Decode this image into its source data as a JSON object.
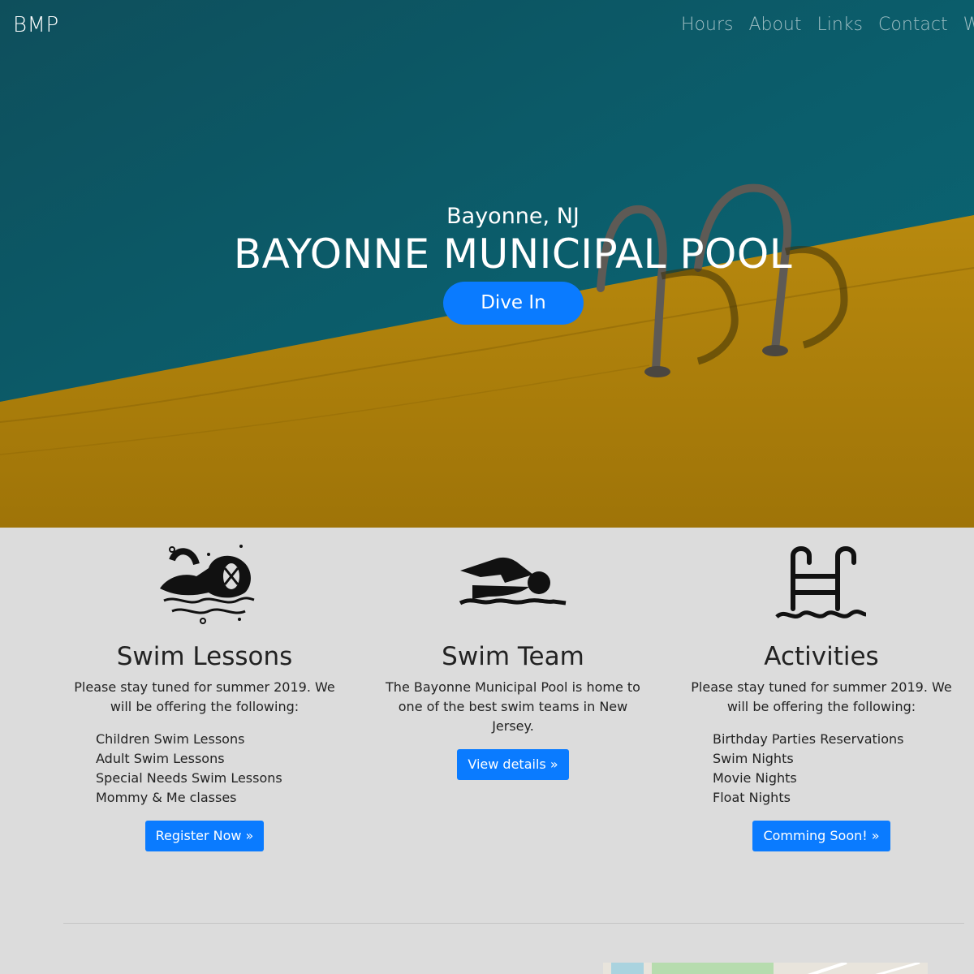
{
  "nav": {
    "brand": "BMP",
    "links": [
      "Hours",
      "About",
      "Links",
      "Contact",
      "Wea"
    ]
  },
  "hero": {
    "subtitle": "Bayonne, NJ",
    "title": "BAYONNE MUNICIPAL POOL",
    "cta": "Dive In"
  },
  "features": [
    {
      "icon": "swimmer-splash-icon",
      "title": "Swim Lessons",
      "text": "Please stay tuned for summer 2019. We will be offering the following:",
      "items": [
        "Children Swim Lessons",
        "Adult Swim Lessons",
        "Special Needs Swim Lessons",
        "Mommy & Me classes"
      ],
      "button": "Register Now »"
    },
    {
      "icon": "swimmer-freestyle-icon",
      "title": "Swim Team",
      "text": "The Bayonne Municipal Pool is home to one of the best swim teams in New Jersey.",
      "button": "View details »"
    },
    {
      "icon": "pool-ladder-icon",
      "title": "Activities",
      "text": "Please stay tuned for summer 2019. We will be offering the following:",
      "items": [
        "Birthday Parties Reservations",
        "Swim Nights",
        "Movie Nights",
        "Float Nights"
      ],
      "button": "Comming Soon! »"
    }
  ],
  "colors": {
    "primary": "#0a7bff",
    "water": "#0b5866",
    "deck": "#b5870c",
    "background": "#dcdcdc"
  }
}
